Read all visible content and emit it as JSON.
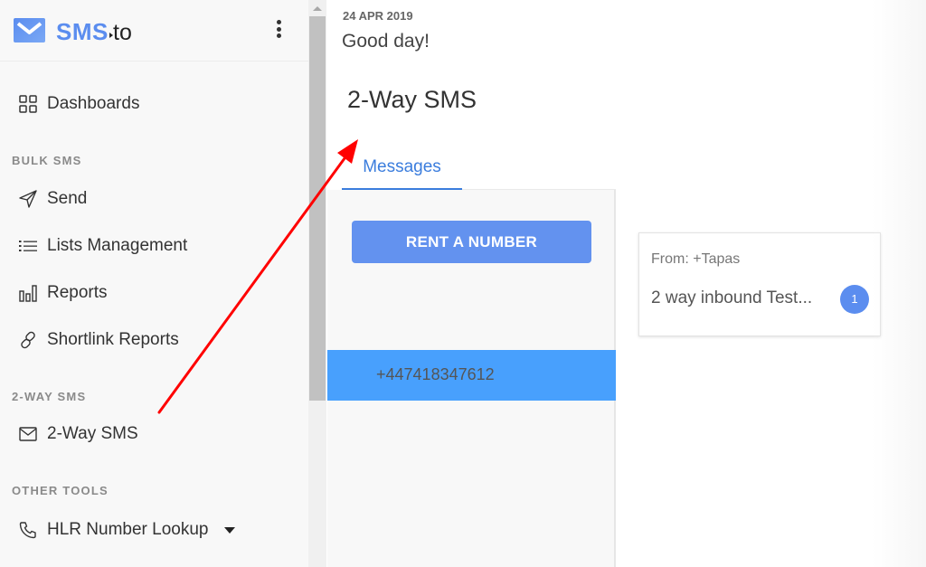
{
  "brand": {
    "name": "SMS",
    "suffix": "to",
    "accent_color": "#5b8def"
  },
  "sidebar": {
    "menu_icon": "kebab-menu-icon",
    "items": [
      {
        "label": "Dashboards",
        "icon": "grid-icon"
      },
      {
        "label": "Send",
        "icon": "paper-plane-icon"
      },
      {
        "label": "Lists Management",
        "icon": "list-icon"
      },
      {
        "label": "Reports",
        "icon": "bar-chart-icon"
      },
      {
        "label": "Shortlink Reports",
        "icon": "link-icon"
      },
      {
        "label": "2-Way SMS",
        "icon": "envelope-icon"
      },
      {
        "label": "HLR Number Lookup",
        "icon": "phone-icon",
        "has_dropdown": true
      }
    ],
    "sections": [
      {
        "label": "BULK SMS"
      },
      {
        "label": "2-WAY SMS"
      },
      {
        "label": "OTHER TOOLS"
      }
    ]
  },
  "header": {
    "date": "24 APR 2019",
    "greeting": "Good day!",
    "page_title": "2-Way SMS"
  },
  "tabs": [
    {
      "label": "Messages",
      "active": true
    }
  ],
  "numbers_panel": {
    "rent_button_label": "RENT A NUMBER",
    "numbers": [
      {
        "value": "+447418347612",
        "selected": true
      }
    ]
  },
  "conversations": [
    {
      "from": "From: +Tapas",
      "preview": "2 way inbound Test...",
      "unread": "1"
    }
  ],
  "annotation": {
    "type": "red-arrow",
    "color": "#ff0000",
    "from": "sidebar 2-Way SMS item",
    "to": "2-Way SMS page title"
  },
  "colors": {
    "tab_active": "#3b7ddd",
    "button": "#6392ef",
    "selected_row": "#48a0fd",
    "badge": "#5b8def"
  }
}
